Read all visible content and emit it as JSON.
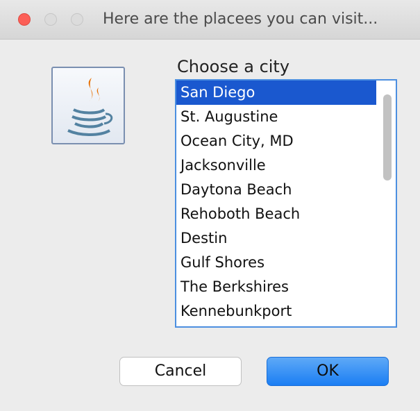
{
  "window": {
    "title": "Here are the placees you can visit...",
    "close_color": "#fc5f57"
  },
  "icon": {
    "name": "java-coffee-cup-icon"
  },
  "prompt": "Choose a city",
  "cities": [
    {
      "label": "San Diego",
      "selected": true
    },
    {
      "label": "St. Augustine",
      "selected": false
    },
    {
      "label": "Ocean City, MD",
      "selected": false
    },
    {
      "label": "Jacksonville",
      "selected": false
    },
    {
      "label": "Daytona Beach",
      "selected": false
    },
    {
      "label": "Rehoboth Beach",
      "selected": false
    },
    {
      "label": "Destin",
      "selected": false
    },
    {
      "label": "Gulf Shores",
      "selected": false
    },
    {
      "label": "The Berkshires",
      "selected": false
    },
    {
      "label": "Kennebunkport",
      "selected": false
    }
  ],
  "buttons": {
    "cancel_label": "Cancel",
    "ok_label": "OK"
  },
  "colors": {
    "selection": "#1a58cf",
    "accent": "#1b7ef3"
  }
}
